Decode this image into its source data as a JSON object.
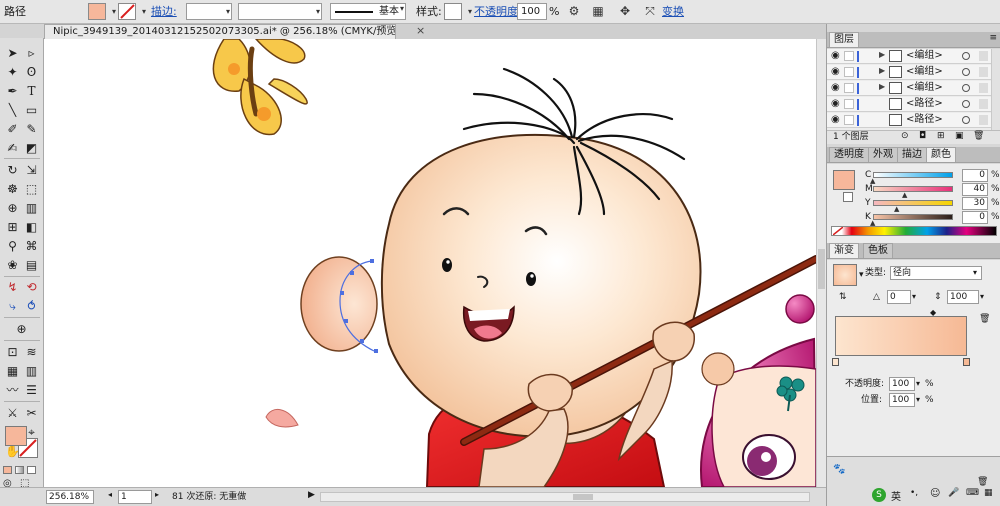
{
  "control_bar": {
    "selection_type": "路径",
    "stroke_label": "描边:",
    "brush_profile": "基本",
    "style_label": "样式:",
    "opacity_label": "不透明度:",
    "opacity_value": "100",
    "opacity_unit": "%",
    "transform_label": "变换"
  },
  "document_tab": {
    "title": "Nipic_3949139_20140312152502073305.ai* @ 256.18% (CMYK/预览)",
    "close": "×"
  },
  "tools": {
    "items": [
      "selection-tool",
      "direct-selection-tool",
      "magic-wand-tool",
      "lasso-tool",
      "pen-tool",
      "type-tool",
      "line-tool",
      "rectangle-tool",
      "paintbrush-tool",
      "pencil-tool",
      "blob-brush-tool",
      "eraser-tool",
      "rotate-tool",
      "scale-tool",
      "warp-tool",
      "free-transform-tool",
      "shape-builder-tool",
      "perspective-grid-tool",
      "mesh-tool",
      "gradient-tool",
      "eyedropper-tool",
      "blend-tool",
      "symbol-sprayer-tool",
      "column-graph-tool",
      "artboard-tool",
      "slice-tool",
      "hand-tool",
      "zoom-tool"
    ]
  },
  "status_bar": {
    "zoom": "256.18%",
    "artboard": "1",
    "info": "81 次还原: 无重做"
  },
  "layers_panel": {
    "tab": "图层",
    "rows": [
      {
        "name": "<编组>",
        "expandable": true
      },
      {
        "name": "<编组>",
        "expandable": true
      },
      {
        "name": "<编组>",
        "expandable": true
      },
      {
        "name": "<路径>",
        "expandable": false
      },
      {
        "name": "<路径>",
        "expandable": false
      }
    ],
    "count": "1 个图层"
  },
  "color_panel": {
    "tabs": [
      "透明度",
      "外观",
      "描边",
      "颜色"
    ],
    "active_tab": "颜色",
    "sliders": [
      {
        "channel": "C",
        "value": "0",
        "from": "#ffffff",
        "to": "#00a0e9",
        "knob": 0.0
      },
      {
        "channel": "M",
        "value": "40",
        "from": "#f7d9c3",
        "to": "#e8317a",
        "knob": 0.4
      },
      {
        "channel": "Y",
        "value": "30",
        "from": "#f5b8c0",
        "to": "#f5d500",
        "knob": 0.3
      },
      {
        "channel": "K",
        "value": "0",
        "from": "#f7c4a8",
        "to": "#2b1f1a",
        "knob": 0.0
      }
    ],
    "unit": "%",
    "fill_color": "#f6b79b"
  },
  "gradient_panel": {
    "tabs": [
      "渐变",
      "色板"
    ],
    "active_tab": "渐变",
    "type_label": "类型:",
    "type_value": "径向",
    "angle_value": "0",
    "ratio_value": "100",
    "opacity_label": "不透明度:",
    "opacity_value": "100",
    "location_label": "位置:",
    "location_value": "100",
    "unit": "%",
    "gradient_from": "#fde5cf",
    "gradient_to": "#f6b995"
  },
  "taskbar": {
    "ime": "英"
  }
}
